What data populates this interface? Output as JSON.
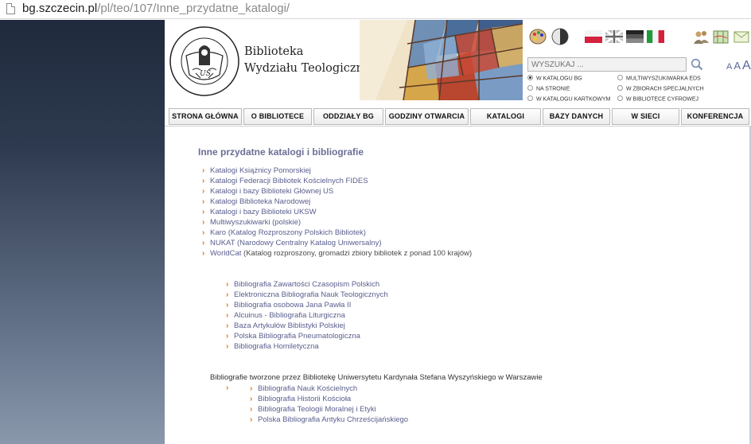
{
  "browser": {
    "url_domain": "bg.szczecin.pl",
    "url_path": "/pl/teo/107/Inne_przydatne_katalogi/"
  },
  "header": {
    "library_line1": "Biblioteka",
    "library_line2": "Wydziału Teologicznego",
    "seal_text_top": "UNIVERSITAS SEDINENSIS",
    "seal_text_bottom": "FACULTAS THEOLOGICA",
    "seal_mark": "US",
    "search_placeholder": "WYSZUKAJ ...",
    "font_size_labels": [
      "A",
      "A",
      "A"
    ],
    "tool_icons": [
      "palette-icon",
      "contrast-icon",
      "flag-pl-icon",
      "flag-en-icon",
      "flag-de-icon",
      "flag-it-icon",
      "users-icon",
      "map-icon",
      "envelope-icon"
    ],
    "search_options": [
      {
        "label": "W KATALOGU BG",
        "selected": true
      },
      {
        "label": "MULTIWYSZUKIWARKA EDS",
        "selected": false
      },
      {
        "label": "NA STRONIE",
        "selected": false
      },
      {
        "label": "W ZBIORACH SPECJALNYCH",
        "selected": false
      },
      {
        "label": "W KATALOGU KARTKOWYM",
        "selected": false
      },
      {
        "label": "W BIBLIOTECE CYFROWEJ",
        "selected": false
      }
    ]
  },
  "nav": {
    "items": [
      "STRONA GŁÓWNA",
      "O BIBLIOTECE",
      "ODDZIAŁY BG",
      "GODZINY OTWARCIA",
      "KATALOGI",
      "BAZY DANYCH",
      "W SIECI",
      "KONFERENCJA"
    ]
  },
  "content": {
    "heading": "Inne przydatne katalogi i bibliografie",
    "catalogs": [
      {
        "label": "Katalogi Książnicy Pomorskiej",
        "extra": ""
      },
      {
        "label": "Katalogi Federacji Bibliotek Kościelnych FIDES",
        "extra": ""
      },
      {
        "label": "Katalogi i bazy Biblioteki Głównej US",
        "extra": ""
      },
      {
        "label": "Katalogi Biblioteka Narodowej",
        "extra": ""
      },
      {
        "label": "Katalogi i bazy Biblioteki UKSW",
        "extra": ""
      },
      {
        "label": "Multiwyszukiwarki (polskie)",
        "extra": ""
      },
      {
        "label": "Karo (Katalog Rozproszony Polskich Bibliotek)",
        "extra": ""
      },
      {
        "label": "NUKAT (Narodowy Centralny Katalog Uniwersalny)",
        "extra": ""
      },
      {
        "label": "WorldCat",
        "extra": " (Katalog rozproszony, gromadzi zbiory bibliotek z ponad 100 krajów)"
      }
    ],
    "bibliographies": [
      "Bibliografia Zawartości Czasopism Polskich",
      "Elektroniczna Bibliografia Nauk Teologicznych",
      "Bibliografia osobowa Jana Pawła II",
      "Alcuinus - Bibliografia Liturgiczna",
      "Baza Artykułów Biblistyki Polskiej",
      "Polska Bibliografia Pneumatologiczna",
      "Bibliografia Homiletyczna"
    ],
    "uksw_note": "Bibliografie tworzone przez Bibliotekę Uniwersytetu Kardynała Stefana Wyszyńskiego w Warszawie",
    "uksw_bibliographies": [
      "Bibliografia Nauk Kościelnych",
      "Bibliografia Historii Kościoła",
      "Bibliografia Teologii Moralnej i Etyki",
      "Polska Bibliografia Antyku Chrześcijańskiego"
    ]
  },
  "colors": {
    "link": "#5a5e8e",
    "bullet": "#e1781e",
    "heading": "#6b6f95",
    "sidebar_dark": "#1f2a3c"
  }
}
